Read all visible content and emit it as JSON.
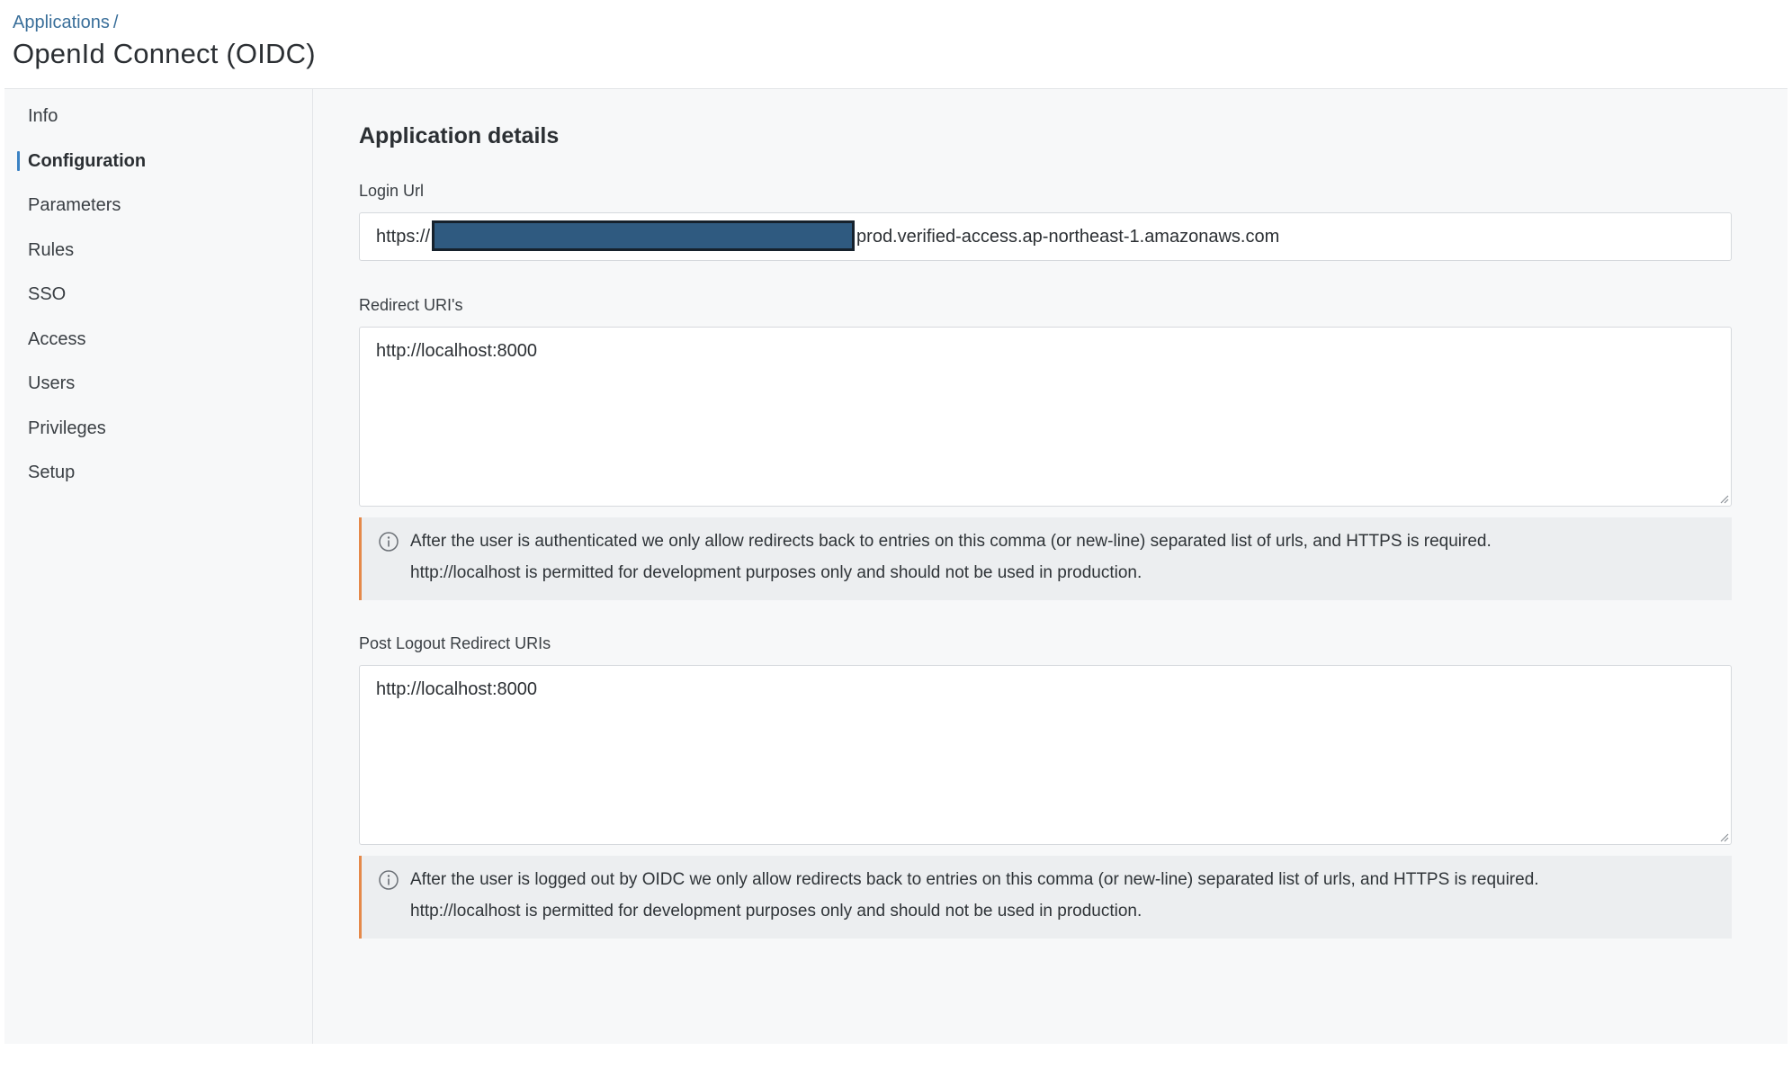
{
  "breadcrumb": {
    "parent": "Applications",
    "separator": "/"
  },
  "page": {
    "title": "OpenId Connect (OIDC)"
  },
  "sidebar": {
    "items": [
      {
        "label": "Info"
      },
      {
        "label": "Configuration",
        "active": true
      },
      {
        "label": "Parameters"
      },
      {
        "label": "Rules"
      },
      {
        "label": "SSO"
      },
      {
        "label": "Access"
      },
      {
        "label": "Users"
      },
      {
        "label": "Privileges"
      },
      {
        "label": "Setup"
      }
    ]
  },
  "details": {
    "title": "Application details",
    "login_url": {
      "label": "Login Url",
      "value_prefix": "https://",
      "value_suffix": "prod.verified-access.ap-northeast-1.amazonaws.com"
    },
    "redirect_uris": {
      "label": "Redirect URI's",
      "value": "http://localhost:8000",
      "notice_line1": "After the user is authenticated we only allow redirects back to entries on this comma (or new-line) separated list of urls, and HTTPS is required.",
      "notice_line2": "http://localhost is permitted for development purposes only and should not be used in production."
    },
    "post_logout_uris": {
      "label": "Post Logout Redirect URIs",
      "value": "http://localhost:8000",
      "notice_line1": "After the user is logged out by OIDC we only allow redirects back to entries on this comma (or new-line) separated list of urls, and HTTPS is required.",
      "notice_line2": "http://localhost is permitted for development purposes only and should not be used in production."
    }
  },
  "colors": {
    "accent": "#3b82c4",
    "link": "#3a6f9a",
    "notice_border": "#e5894a",
    "redaction": "#2f5a80"
  }
}
